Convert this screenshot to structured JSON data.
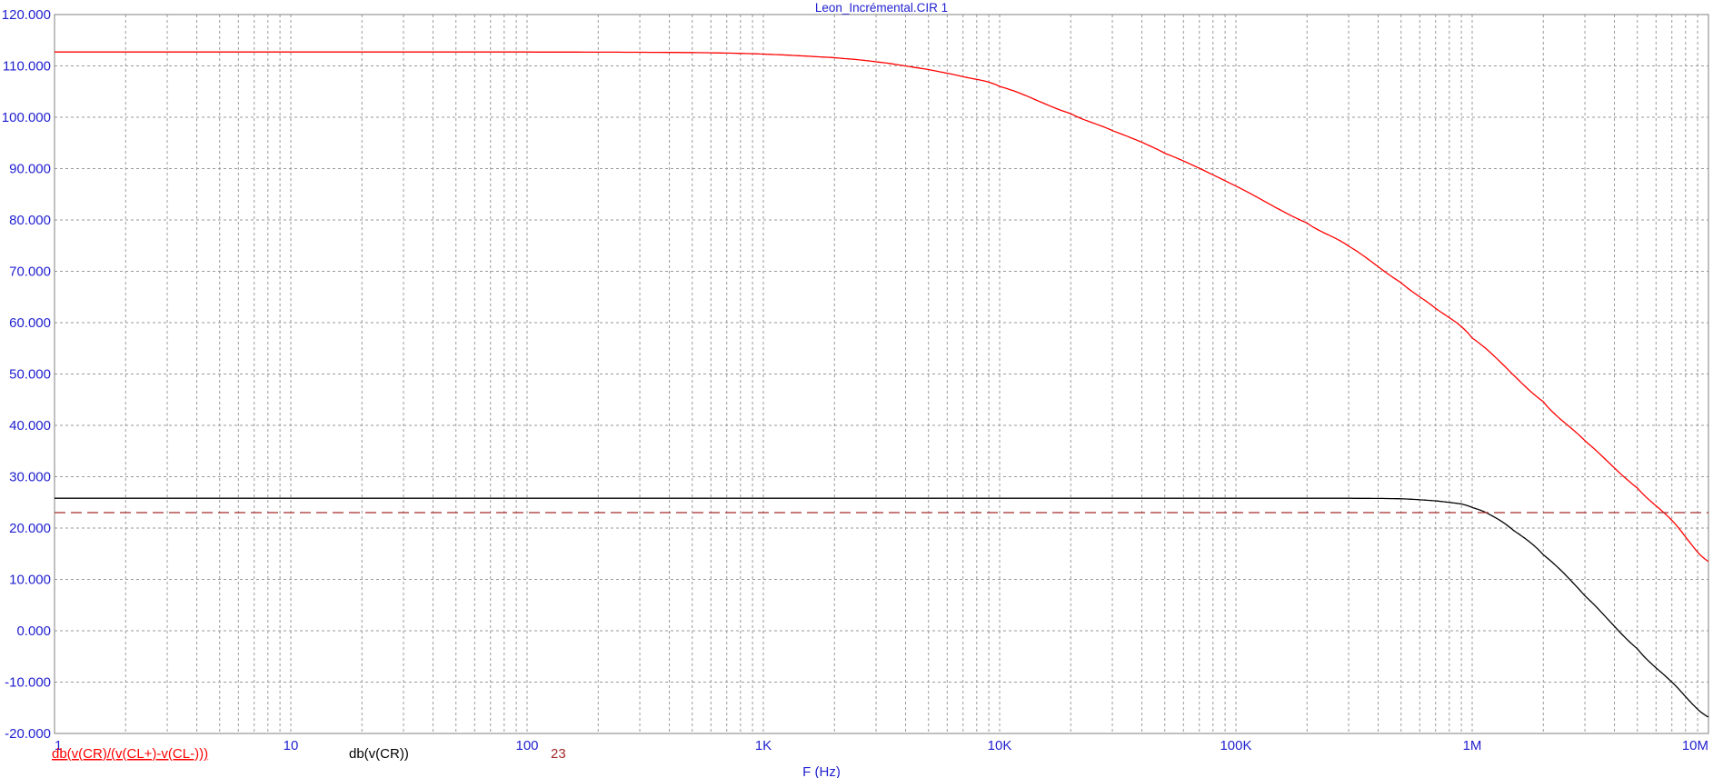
{
  "chart_data": {
    "type": "line",
    "title": "Leon_Incrémental.CIR 1",
    "xlabel": "F (Hz)",
    "ylabel": "",
    "x_scale": "log",
    "xlim": [
      1,
      10000000
    ],
    "ylim": [
      -20,
      120
    ],
    "grid": true,
    "x_ticks": [
      {
        "value": 1,
        "label": "1"
      },
      {
        "value": 10,
        "label": "10"
      },
      {
        "value": 100,
        "label": "100"
      },
      {
        "value": 1000,
        "label": "1K"
      },
      {
        "value": 10000,
        "label": "10K"
      },
      {
        "value": 100000,
        "label": "100K"
      },
      {
        "value": 1000000,
        "label": "1M"
      },
      {
        "value": 10000000,
        "label": "10M"
      }
    ],
    "y_ticks": [
      {
        "value": 120,
        "label": "120.000"
      },
      {
        "value": 110,
        "label": "110.000"
      },
      {
        "value": 100,
        "label": "100.000"
      },
      {
        "value": 90,
        "label": "90.000"
      },
      {
        "value": 80,
        "label": "80.000"
      },
      {
        "value": 70,
        "label": "70.000"
      },
      {
        "value": 60,
        "label": "60.000"
      },
      {
        "value": 50,
        "label": "50.000"
      },
      {
        "value": 40,
        "label": "40.000"
      },
      {
        "value": 30,
        "label": "30.000"
      },
      {
        "value": 20,
        "label": "20.000"
      },
      {
        "value": 10,
        "label": "10.000"
      },
      {
        "value": 0,
        "label": "0.000"
      },
      {
        "value": -10,
        "label": "-10.000"
      },
      {
        "value": -20,
        "label": "-20.000"
      }
    ],
    "series": [
      {
        "name": "db(v(CR)/(v(CL+)-v(CL-)))",
        "color": "#ff0000",
        "style": "solid",
        "x": [
          1,
          10,
          100,
          500,
          1000,
          2000,
          3000,
          5000,
          7000,
          10000,
          20000,
          30000,
          50000,
          100000,
          200000,
          300000,
          500000,
          700000,
          1000000,
          2000000,
          3000000,
          5000000,
          7000000,
          10000000
        ],
        "y": [
          112.7,
          112.7,
          112.7,
          112.6,
          112.3,
          111.6,
          110.8,
          109.3,
          107.9,
          106.0,
          100.7,
          97.4,
          93.0,
          86.6,
          79.4,
          74.9,
          67.8,
          62.8,
          57.0,
          44.6,
          37.0,
          27.8,
          21.5,
          13.5
        ]
      },
      {
        "name": "db(v(CR))",
        "color": "#000000",
        "style": "solid",
        "x": [
          1,
          10,
          100,
          1000,
          10000,
          100000,
          300000,
          500000,
          700000,
          900000,
          1000000,
          1200000,
          1500000,
          2000000,
          3000000,
          5000000,
          7000000,
          10000000
        ],
        "y": [
          25.8,
          25.8,
          25.8,
          25.8,
          25.8,
          25.8,
          25.8,
          25.7,
          25.3,
          24.7,
          24.0,
          22.5,
          19.5,
          14.8,
          6.8,
          -3.5,
          -10.0,
          -16.8
        ]
      },
      {
        "name": "23",
        "color": "#a52a2a",
        "style": "dashed",
        "x": [
          1,
          10000000
        ],
        "y": [
          23,
          23
        ]
      }
    ]
  }
}
